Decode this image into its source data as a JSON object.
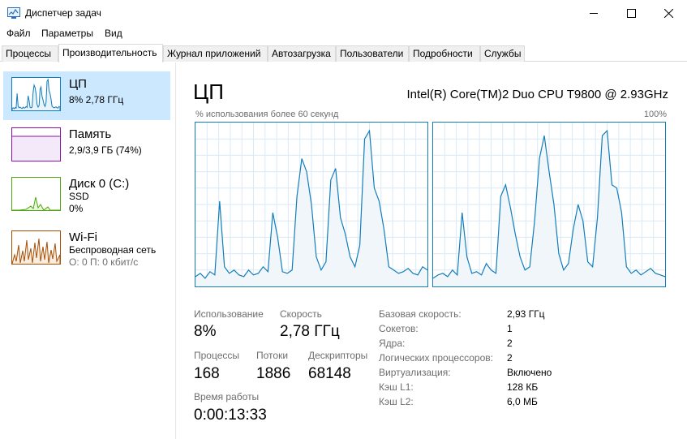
{
  "window": {
    "title": "Диспетчер задач"
  },
  "menu": [
    "Файл",
    "Параметры",
    "Вид"
  ],
  "tabs": [
    "Процессы",
    "Производительность",
    "Журнал приложений",
    "Автозагрузка",
    "Пользователи",
    "Подробности",
    "Службы"
  ],
  "active_tab": 1,
  "sidebar": {
    "items": [
      {
        "name": "ЦП",
        "sub1": "8% 2,78 ГГц",
        "sub2": "",
        "color": "#117dbb"
      },
      {
        "name": "Память",
        "sub1": "2,9/3,9 ГБ (74%)",
        "sub2": "",
        "color": "#8b12ae"
      },
      {
        "name": "Диск 0 (C:)",
        "sub1": "SSD",
        "sub2": "0%",
        "color": "#4da60c"
      },
      {
        "name": "Wi-Fi",
        "sub1": "Беспроводная сеть",
        "sub2": "О: 0 П: 0 кбит/с",
        "color": "#a74f01"
      }
    ]
  },
  "main": {
    "title": "ЦП",
    "cpu_model": "Intel(R) Core(TM)2 Duo CPU T9800 @ 2.93GHz",
    "graph_label": "% использования более 60 секунд",
    "graph_max": "100%",
    "stats": {
      "usage_label": "Использование",
      "usage_value": "8%",
      "speed_label": "Скорость",
      "speed_value": "2,78 ГГц",
      "processes_label": "Процессы",
      "processes_value": "168",
      "threads_label": "Потоки",
      "threads_value": "1886",
      "handles_label": "Дескрипторы",
      "handles_value": "68148",
      "uptime_label": "Время работы",
      "uptime_value": "0:00:13:33"
    },
    "info": [
      {
        "label": "Базовая скорость:",
        "value": "2,93 ГГц"
      },
      {
        "label": "Сокетов:",
        "value": "1"
      },
      {
        "label": "Ядра:",
        "value": "2"
      },
      {
        "label": "Логических процессоров:",
        "value": "2"
      },
      {
        "label": "Виртуализация:",
        "value": "Включено"
      },
      {
        "label": "Кэш L1:",
        "value": "128 КБ"
      },
      {
        "label": "Кэш L2:",
        "value": "6,0 МБ"
      }
    ]
  },
  "graphs": {
    "core0": [
      6,
      8,
      5,
      9,
      7,
      52,
      12,
      8,
      10,
      7,
      6,
      10,
      7,
      8,
      12,
      9,
      45,
      30,
      9,
      8,
      10,
      55,
      78,
      70,
      50,
      18,
      10,
      15,
      65,
      72,
      42,
      32,
      18,
      12,
      25,
      90,
      95,
      60,
      52,
      35,
      12,
      10,
      8,
      9,
      11,
      8,
      7,
      12,
      10
    ],
    "core1": [
      5,
      7,
      8,
      6,
      10,
      7,
      45,
      18,
      8,
      9,
      7,
      14,
      10,
      8,
      55,
      62,
      48,
      32,
      18,
      10,
      12,
      40,
      78,
      92,
      70,
      50,
      20,
      10,
      14,
      35,
      50,
      40,
      15,
      12,
      42,
      92,
      95,
      62,
      60,
      45,
      12,
      8,
      10,
      7,
      9,
      11,
      8,
      7,
      6
    ]
  }
}
